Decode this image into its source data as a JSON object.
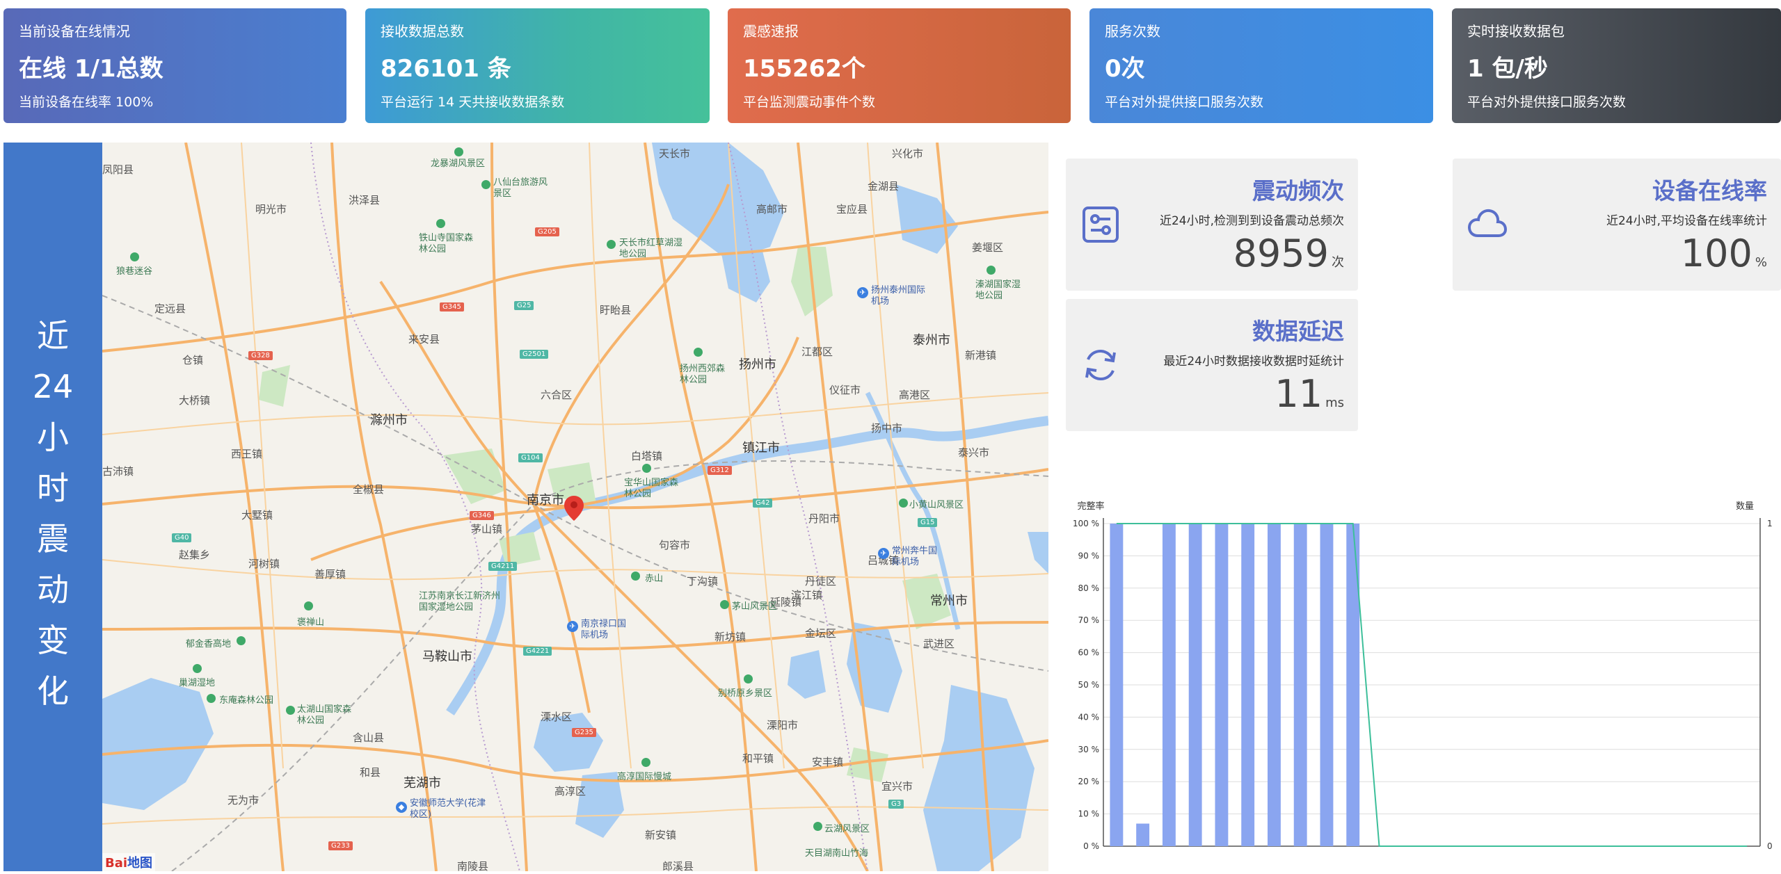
{
  "stats": [
    {
      "title": "当前设备在线情况",
      "value": "在线 1/1总数",
      "sub": "当前设备在线率 100%"
    },
    {
      "title": "接收数据总数",
      "value": "826101 条",
      "sub": "平台运行 14 天共接收数据条数"
    },
    {
      "title": "震感速报",
      "value": "155262个",
      "sub": "平台监测震动事件个数"
    },
    {
      "title": "服务次数",
      "value": "0次",
      "sub": "平台对外提供接口服务次数"
    },
    {
      "title": "实时接收数据包",
      "value": "1 包/秒",
      "sub": "平台对外提供接口服务次数"
    }
  ],
  "side_label": [
    "近",
    "24",
    "小",
    "时",
    "震",
    "动",
    "变",
    "化"
  ],
  "map": {
    "cities": [
      "南京市",
      "扬州市",
      "镇江市",
      "滁州市",
      "马鞍山市",
      "芜湖市",
      "常州市",
      "泰州市"
    ],
    "places": [
      "凤阳县",
      "明光市",
      "定远县",
      "来安县",
      "全椒县",
      "大墅镇",
      "仓镇",
      "古沛镇",
      "大桥镇",
      "西王镇",
      "赵集乡",
      "河树镇",
      "善厚镇",
      "含山县",
      "和县",
      "无为市",
      "六合区",
      "句容市",
      "丹阳市",
      "扬中市",
      "高港区",
      "泰兴市",
      "金坛区",
      "溧阳市",
      "高淳区",
      "武进区",
      "宜兴市",
      "兴化市",
      "高邮市",
      "姜堰区",
      "洪泽县",
      "盱眙县",
      "天长市",
      "金湖县",
      "宝应县",
      "仪征市",
      "江都区",
      "溧水区",
      "茅山镇",
      "新安镇",
      "丹徒区",
      "延陵镇",
      "白塔镇",
      "丁沟镇",
      "吕城镇",
      "新坊镇",
      "和平镇",
      "安丰镇",
      "滨江镇",
      "郎溪县",
      "南陵县",
      "新港镇"
    ],
    "parks": [
      "龙暴湖风景区",
      "八仙台旅游风景区",
      "铁山寺国家森林公园",
      "天长市红草湖湿地公园",
      "扬州西郊森林公园",
      "宝华山国家森林公园",
      "茅山风景区",
      "别桥原乡景区",
      "小黄山风景区",
      "溱湖国家湿地公园",
      "江苏南京长江新济州国家湿地公园",
      "褒禅山",
      "郁金香高地",
      "东庵森林公园",
      "太湖山国家森林公园",
      "高淳国际慢城",
      "云湖风景区",
      "天目湖南山竹海",
      "狼巷迷谷",
      "巢湖湿地",
      "赤山"
    ],
    "airports": [
      "扬州泰州国际机场",
      "常州奔牛国际机场",
      "南京禄口国际机场",
      "安徽师范大学(花津校区)"
    ],
    "roads": [
      "G328",
      "G345",
      "G205",
      "G25",
      "G2501",
      "G40",
      "G312",
      "G42",
      "G346",
      "G104",
      "G4211",
      "G4221",
      "G235",
      "G233",
      "G15",
      "G3"
    ],
    "logo_a": "Bai",
    "logo_b": "地图"
  },
  "info_cards": [
    {
      "title": "震动频次",
      "sub": "近24小时,检测到到设备震动总频次",
      "value": "8959",
      "unit": "次",
      "icon": "sliders-icon"
    },
    {
      "title": "设备在线率",
      "sub": "近24小时,平均设备在线率统计",
      "value": "100",
      "unit": "%",
      "icon": "cloud-icon"
    },
    {
      "title": "数据延迟",
      "sub": "最近24小时数据接收数据时延统计",
      "value": "11",
      "unit": "ms",
      "icon": "refresh-icon"
    }
  ],
  "chart_data": {
    "type": "bar",
    "left_axis_label": "完整率",
    "right_axis_label": "数量",
    "left_ticks": [
      "100 %",
      "90 %",
      "80 %",
      "70 %",
      "60 %",
      "50 %",
      "40 %",
      "30 %",
      "20 %",
      "10 %",
      "0 %"
    ],
    "right_ticks": [
      "1",
      "0"
    ],
    "ylim_left": [
      0,
      100
    ],
    "ylim_right": [
      0,
      1
    ],
    "grid": true,
    "series": [
      {
        "type": "bar",
        "values": [
          100,
          7,
          100,
          100,
          100,
          100,
          100,
          100,
          100,
          100,
          0,
          0,
          0,
          0,
          0,
          0,
          0,
          0,
          0,
          0,
          0,
          0,
          0,
          0,
          0
        ],
        "color": "#8aa5f0"
      },
      {
        "type": "line",
        "values": [
          1,
          1,
          1,
          1,
          1,
          1,
          1,
          1,
          1,
          1,
          0,
          0,
          0,
          0,
          0,
          0,
          0,
          0,
          0,
          0,
          0,
          0,
          0,
          0,
          0
        ],
        "color": "#3dbf9a"
      }
    ]
  },
  "colors": {
    "accent": "#5a6fc9",
    "side": "#4278c9"
  }
}
